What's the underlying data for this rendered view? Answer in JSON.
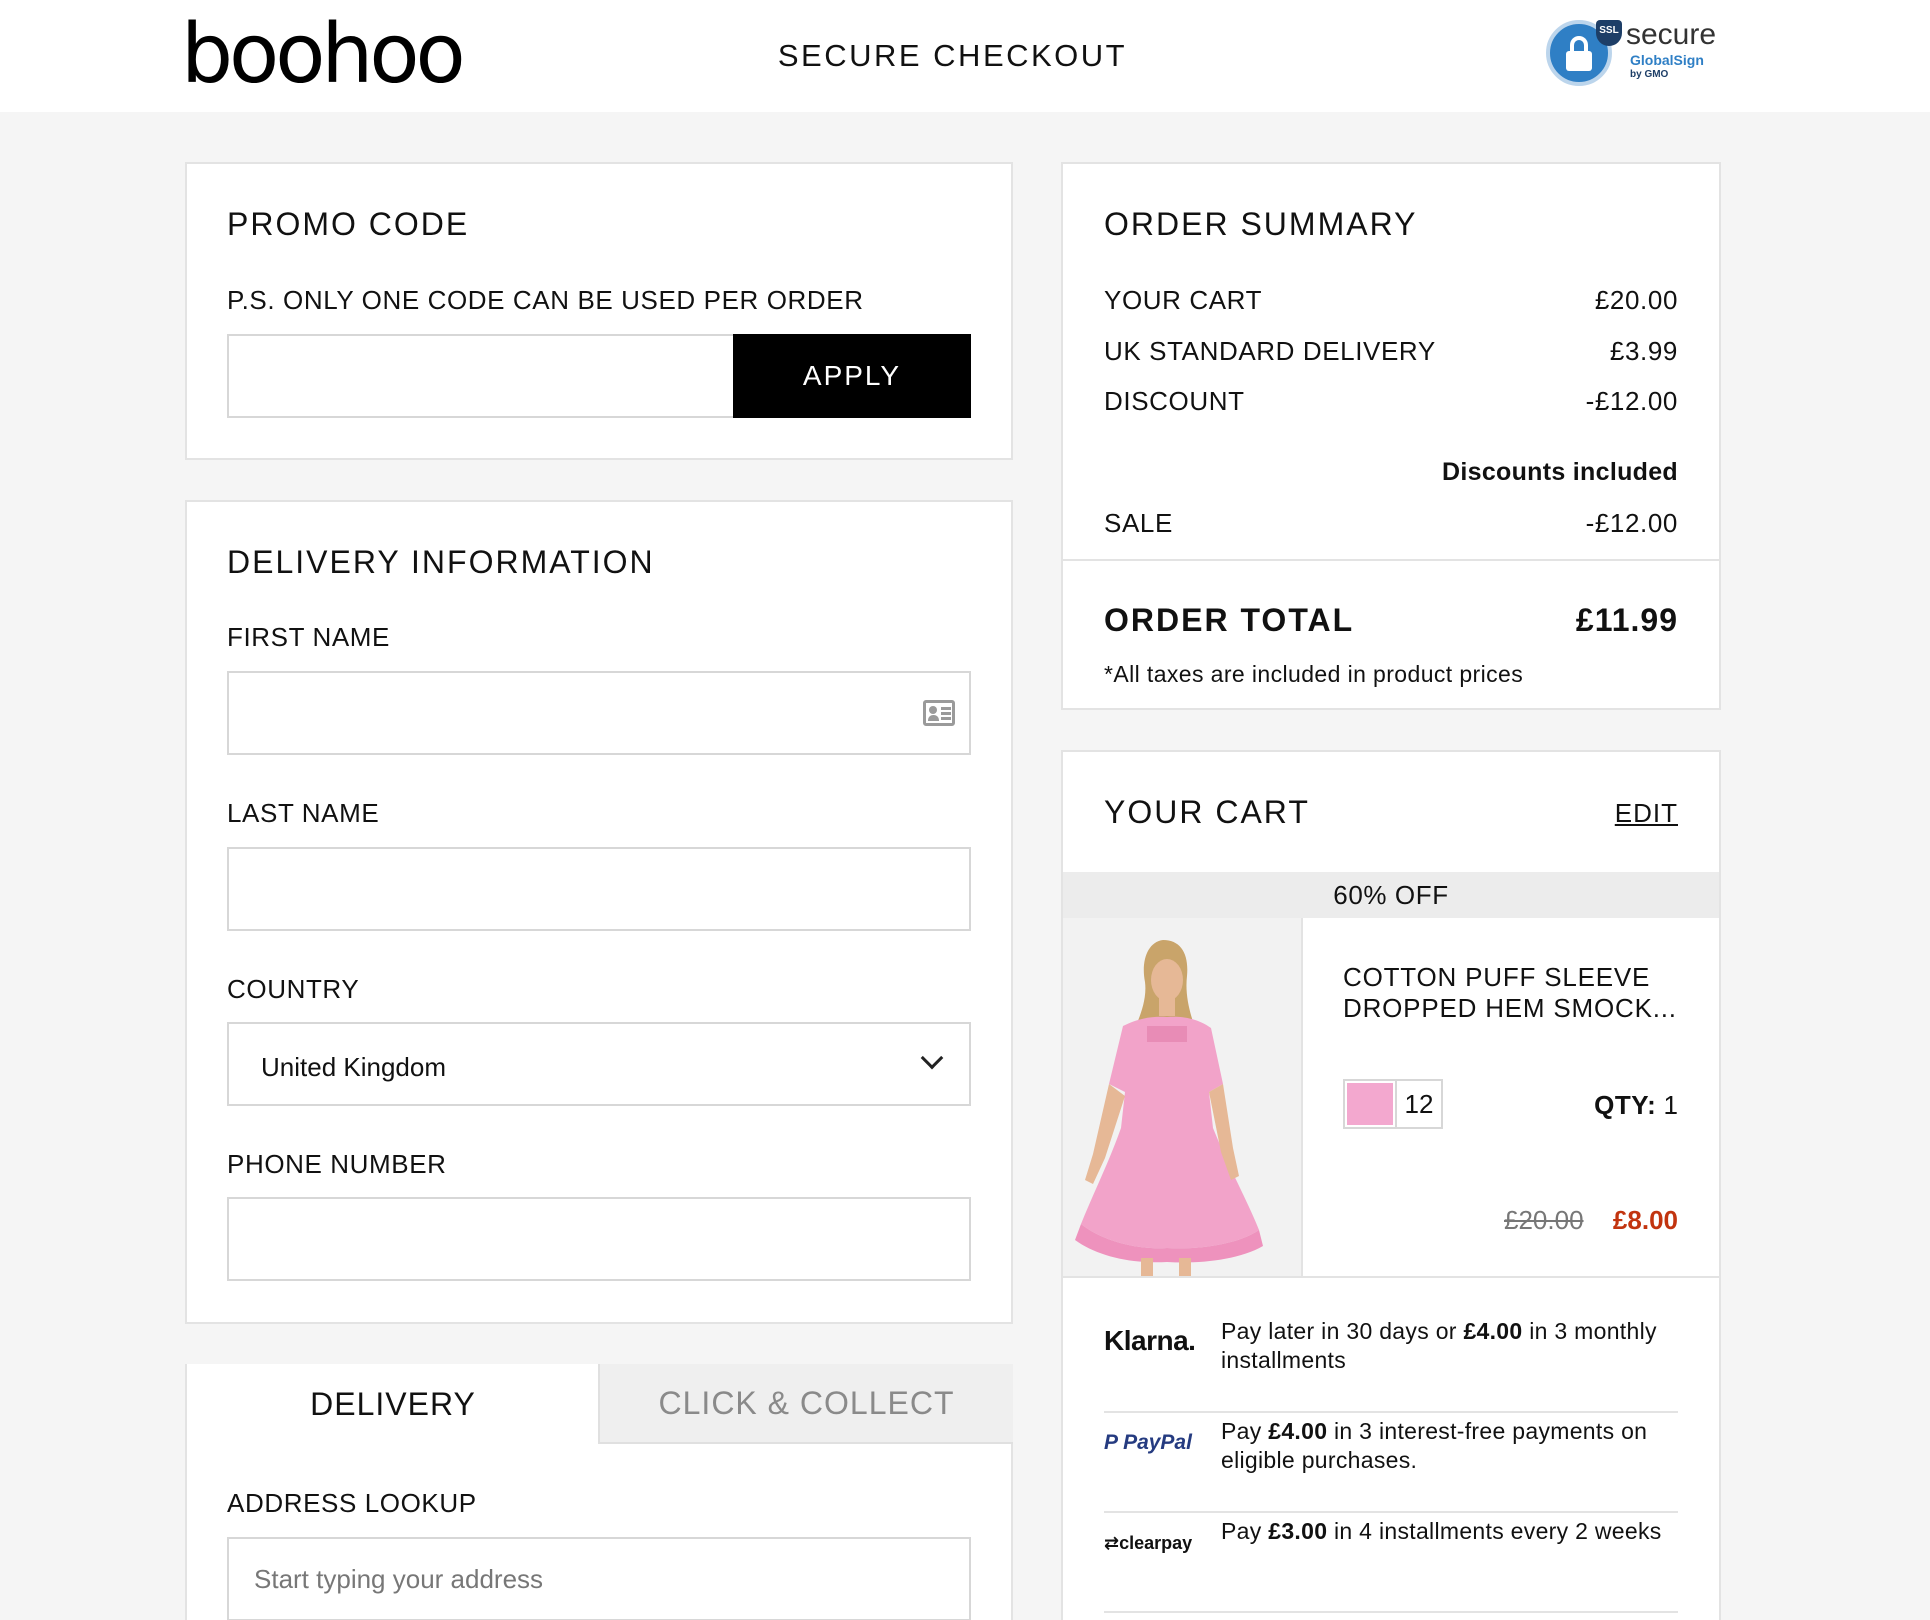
{
  "header": {
    "logo": "boohoo",
    "title": "SECURE CHECKOUT",
    "seal": {
      "ssl": "SSL",
      "secure": "secure",
      "brand": "GlobalSign",
      "sub": "by GMO"
    }
  },
  "promo": {
    "title": "PROMO CODE",
    "note": "P.S. ONLY ONE CODE CAN BE USED PER ORDER",
    "code_value": "",
    "apply_label": "APPLY"
  },
  "delivery": {
    "title": "DELIVERY INFORMATION",
    "first_name_label": "FIRST NAME",
    "first_name_value": "",
    "last_name_label": "LAST NAME",
    "last_name_value": "",
    "country_label": "COUNTRY",
    "country_value": "United Kingdom",
    "phone_label": "PHONE NUMBER",
    "phone_value": ""
  },
  "method_tabs": {
    "tabs": [
      {
        "label": "DELIVERY",
        "active": true
      },
      {
        "label": "CLICK & COLLECT",
        "active": false
      }
    ],
    "address_label": "ADDRESS LOOKUP",
    "address_placeholder": "Start typing your address"
  },
  "summary": {
    "title": "ORDER SUMMARY",
    "rows": [
      {
        "label": "YOUR CART",
        "value": "£20.00"
      },
      {
        "label": "UK STANDARD DELIVERY",
        "value": "£3.99"
      },
      {
        "label": "DISCOUNT",
        "value": "-£12.00"
      }
    ],
    "discounts_heading": "Discounts included",
    "discount_rows": [
      {
        "label": "SALE",
        "value": "-£12.00"
      }
    ],
    "total_label": "ORDER TOTAL",
    "total_value": "£11.99",
    "tax_note": "*All taxes are included in product prices"
  },
  "cart": {
    "title": "YOUR CART",
    "edit_label": "EDIT",
    "offer": "60% OFF",
    "item": {
      "name": "COTTON PUFF SLEEVE DROPPED HEM SMOCK...",
      "color": "#f3a8cf",
      "size": "12",
      "qty_label": "QTY:",
      "qty": "1",
      "old_price": "£20.00",
      "new_price": "£8.00"
    },
    "payments": [
      {
        "logo": "Klarna.",
        "before": "Pay later in 30 days or ",
        "amount": "£4.00",
        "after": " in 3 monthly installments"
      },
      {
        "logo": "PayPal",
        "before": "Pay ",
        "amount": "£4.00",
        "after": " in 3 interest-free payments on eligible purchases."
      },
      {
        "logo": "clearpay",
        "before": "Pay ",
        "amount": "£3.00",
        "after": " in 4 installments every 2 weeks"
      }
    ]
  }
}
